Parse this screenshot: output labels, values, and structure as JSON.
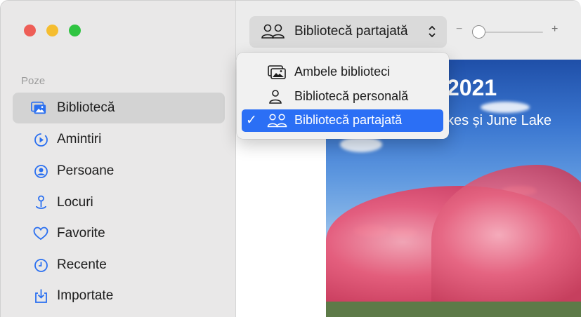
{
  "window": {
    "traffic_lights": [
      "close",
      "minimize",
      "maximize"
    ]
  },
  "sidebar": {
    "section_title": "Poze",
    "items": [
      {
        "label": "Bibliotecă",
        "icon": "photo-library-icon",
        "selected": true
      },
      {
        "label": "Amintiri",
        "icon": "memories-icon",
        "selected": false
      },
      {
        "label": "Persoane",
        "icon": "person-circle-icon",
        "selected": false
      },
      {
        "label": "Locuri",
        "icon": "map-pin-icon",
        "selected": false
      },
      {
        "label": "Favorite",
        "icon": "heart-icon",
        "selected": false
      },
      {
        "label": "Recente",
        "icon": "clock-icon",
        "selected": false
      },
      {
        "label": "Importate",
        "icon": "import-icon",
        "selected": false
      }
    ]
  },
  "toolbar": {
    "library_selector": {
      "label": "Bibliotecă partajată",
      "icon": "shared-people-icon"
    },
    "zoom_minus": "−",
    "zoom_plus": "+",
    "zoom_level": 0.0
  },
  "photo": {
    "title": "2021",
    "subtitle": "kes și June Lake"
  },
  "library_menu": {
    "items": [
      {
        "label": "Ambele biblioteci",
        "icon": "photo-library-icon",
        "checked": false
      },
      {
        "label": "Bibliotecă personală",
        "icon": "person-icon",
        "checked": false
      },
      {
        "label": "Bibliotecă partajată",
        "icon": "shared-people-icon",
        "checked": true
      }
    ],
    "check_mark": "✓"
  },
  "colors": {
    "accent": "#2b6ff5",
    "sidebar_icon": "#2a6ff0"
  }
}
